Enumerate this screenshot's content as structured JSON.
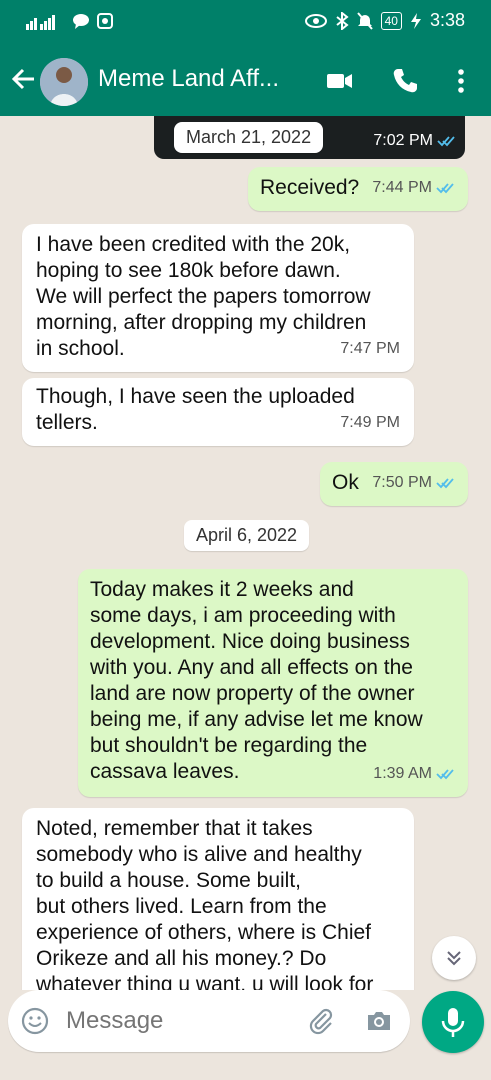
{
  "status_bar": {
    "time": "3:38",
    "battery": "40"
  },
  "header": {
    "title": "Meme Land Aff..."
  },
  "messages": [
    {
      "id": "m1",
      "direction": "in",
      "text": "I have been credited with the 20k,\nhoping to see 180k before dawn.\nWe will perfect the papers tomorrow\nmorning, after dropping my children\nin school.",
      "time": "7:47 PM"
    },
    {
      "id": "m2",
      "direction": "in",
      "text": "Though, I have seen the uploaded\ntellers.",
      "time": "7:49 PM"
    },
    {
      "id": "m3",
      "direction": "out",
      "text": "Received?",
      "time": "7:44 PM",
      "read": true
    },
    {
      "id": "m4",
      "direction": "out",
      "text": "Ok",
      "time": "7:50 PM",
      "read": true
    },
    {
      "id": "m5",
      "direction": "out",
      "text": "Today makes it 2 weeks and\nsome days, i am proceeding with\ndevelopment. Nice doing business\nwith you. Any and all effects on the\nland are now property of the owner\nbeing me, if any advise let me know\nbut shouldn't be regarding the\ncassava leaves.",
      "time": "1:39 AM",
      "read": true
    },
    {
      "id": "m6",
      "direction": "in",
      "text": "Noted, remember that it takes\nsomebody who is alive and healthy\nto build a house. Some built,\nbut others lived. Learn from the\nexperience of others, where is Chief\nOrikeze and all his money.? Do\nwhatever thing u want, u will look for",
      "time": ""
    }
  ],
  "date_separators": {
    "first": "March 21, 2022",
    "second": "April 6, 2022"
  },
  "media_message": {
    "time": "7:02 PM",
    "read": true
  },
  "composer": {
    "placeholder": "Message"
  },
  "colors": {
    "header": "#008069",
    "outgoing_bubble": "#dcf8c6",
    "incoming_bubble": "#ffffff",
    "read_ticks": "#53bdeb",
    "mic_button": "#00a884",
    "chat_background": "#ece5dd"
  },
  "icons": [
    "back-arrow-icon",
    "video-call-icon",
    "phone-icon",
    "more-vert-icon",
    "emoji-icon",
    "attach-icon",
    "camera-icon",
    "mic-icon",
    "chevron-down-double-icon"
  ]
}
